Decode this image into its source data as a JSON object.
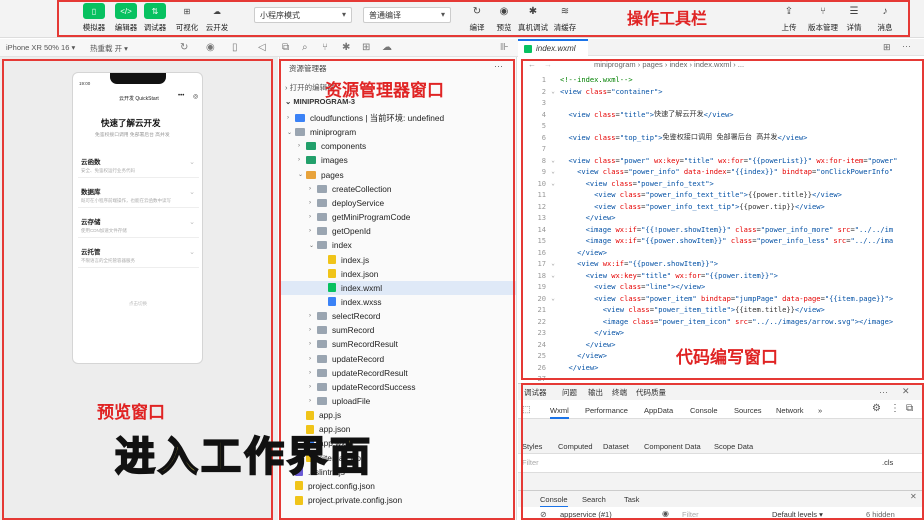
{
  "toolbar": {
    "left_buttons": [
      {
        "label": "模拟器",
        "icon": "phone-icon",
        "glyph": "▯"
      },
      {
        "label": "编辑器",
        "icon": "code-icon",
        "glyph": "</>"
      },
      {
        "label": "调试器",
        "icon": "debug-icon",
        "glyph": "⇅"
      },
      {
        "label": "可视化",
        "icon": "grid-icon",
        "glyph": "⊞"
      },
      {
        "label": "云开发",
        "icon": "cloud-icon",
        "glyph": "☁"
      }
    ],
    "mode_select": "小程序模式",
    "compile_select": "普通编译",
    "mid_buttons": [
      {
        "label": "编译",
        "icon": "refresh-icon",
        "glyph": "↻"
      },
      {
        "label": "预览",
        "icon": "eye-icon",
        "glyph": "◉"
      },
      {
        "label": "真机调试",
        "icon": "bug-icon",
        "glyph": "✱"
      },
      {
        "label": "清缓存",
        "icon": "layers-icon",
        "glyph": "≋"
      }
    ],
    "right_buttons": [
      {
        "label": "上传",
        "icon": "upload-icon",
        "glyph": "⇪"
      },
      {
        "label": "版本管理",
        "icon": "branch-icon",
        "glyph": "⑂"
      },
      {
        "label": "详情",
        "icon": "menu-icon",
        "glyph": "☰"
      },
      {
        "label": "消息",
        "icon": "bell-icon",
        "glyph": "♪"
      }
    ]
  },
  "subbar": {
    "device": "iPhone XR 50% 16 ▾",
    "hotreload": "热重载 开 ▾"
  },
  "annotations": {
    "toolbar": "操作工具栏",
    "explorer": "资源管理器窗口",
    "editor": "代码编写窗口",
    "preview": "预览窗口"
  },
  "subtitle": "进入工作界面",
  "preview": {
    "nav_title": "云开发 QuickStart",
    "time": "19:00",
    "heading": "快速了解云开发",
    "subheading": "免鉴权接口调用 免部署后台 高并发",
    "cards": [
      {
        "title": "云函数",
        "sub": "安全、免鉴权运行业务代码"
      },
      {
        "title": "数据库",
        "sub": "既可在小程序前端操作，也能在云函数中读写"
      },
      {
        "title": "云存储",
        "sub": "使用CDN加速文件存储"
      },
      {
        "title": "云托管",
        "sub": "不限语言的全托管容器服务"
      }
    ],
    "footer": "点击切换"
  },
  "explorer": {
    "title": "资源管理器",
    "opened_label": "打开的编辑器",
    "project": "MINIPROGRAM-3",
    "tree": [
      {
        "label": "cloudfunctions | 当前环境: undefined",
        "depth": 0,
        "arrow": "›",
        "type": "folder-cloud"
      },
      {
        "label": "miniprogram",
        "depth": 0,
        "arrow": "⌄",
        "type": "folder"
      },
      {
        "label": "components",
        "depth": 1,
        "arrow": "›",
        "type": "folder-green"
      },
      {
        "label": "images",
        "depth": 1,
        "arrow": "›",
        "type": "folder-green"
      },
      {
        "label": "pages",
        "depth": 1,
        "arrow": "⌄",
        "type": "folder-orange"
      },
      {
        "label": "createCollection",
        "depth": 2,
        "arrow": "›",
        "type": "folder"
      },
      {
        "label": "deployService",
        "depth": 2,
        "arrow": "›",
        "type": "folder"
      },
      {
        "label": "getMiniProgramCode",
        "depth": 2,
        "arrow": "›",
        "type": "folder"
      },
      {
        "label": "getOpenId",
        "depth": 2,
        "arrow": "›",
        "type": "folder"
      },
      {
        "label": "index",
        "depth": 2,
        "arrow": "⌄",
        "type": "folder"
      },
      {
        "label": "index.js",
        "depth": 3,
        "arrow": "",
        "type": "js"
      },
      {
        "label": "index.json",
        "depth": 3,
        "arrow": "",
        "type": "json"
      },
      {
        "label": "index.wxml",
        "depth": 3,
        "arrow": "",
        "type": "wxml",
        "selected": true
      },
      {
        "label": "index.wxss",
        "depth": 3,
        "arrow": "",
        "type": "wxss"
      },
      {
        "label": "selectRecord",
        "depth": 2,
        "arrow": "›",
        "type": "folder"
      },
      {
        "label": "sumRecord",
        "depth": 2,
        "arrow": "›",
        "type": "folder"
      },
      {
        "label": "sumRecordResult",
        "depth": 2,
        "arrow": "›",
        "type": "folder"
      },
      {
        "label": "updateRecord",
        "depth": 2,
        "arrow": "›",
        "type": "folder"
      },
      {
        "label": "updateRecordResult",
        "depth": 2,
        "arrow": "›",
        "type": "folder"
      },
      {
        "label": "updateRecordSuccess",
        "depth": 2,
        "arrow": "›",
        "type": "folder"
      },
      {
        "label": "uploadFile",
        "depth": 2,
        "arrow": "›",
        "type": "folder"
      },
      {
        "label": "app.js",
        "depth": 1,
        "arrow": "",
        "type": "js"
      },
      {
        "label": "app.json",
        "depth": 1,
        "arrow": "",
        "type": "json"
      },
      {
        "label": "app.wxss",
        "depth": 1,
        "arrow": "",
        "type": "wxss"
      },
      {
        "label": "sitemap.json",
        "depth": 1,
        "arrow": "",
        "type": "json"
      },
      {
        "label": ".eslintrc.js",
        "depth": 0,
        "arrow": "",
        "type": "eslint"
      },
      {
        "label": "project.config.json",
        "depth": 0,
        "arrow": "",
        "type": "json"
      },
      {
        "label": "project.private.config.json",
        "depth": 0,
        "arrow": "",
        "type": "json"
      }
    ]
  },
  "editor": {
    "tab": "index.wxml",
    "breadcrumb": "miniprogram › pages › index › index.wxml › ...",
    "lines": [
      [
        {
          "c": "cm",
          "t": "<!--index.wxml-->"
        }
      ],
      [
        {
          "c": "v",
          "t": "<view"
        },
        {
          "c": "a",
          "t": " class"
        },
        {
          "c": "tx",
          "t": "="
        },
        {
          "c": "v",
          "t": "\"container\""
        },
        {
          "c": "v",
          "t": ">"
        }
      ],
      [],
      [
        {
          "c": "v",
          "t": "  <view"
        },
        {
          "c": "a",
          "t": " class"
        },
        {
          "c": "tx",
          "t": "="
        },
        {
          "c": "v",
          "t": "\"title\""
        },
        {
          "c": "v",
          "t": ">"
        },
        {
          "c": "tx",
          "t": "快速了解云开发"
        },
        {
          "c": "v",
          "t": "</view>"
        }
      ],
      [],
      [
        {
          "c": "v",
          "t": "  <view"
        },
        {
          "c": "a",
          "t": " class"
        },
        {
          "c": "tx",
          "t": "="
        },
        {
          "c": "v",
          "t": "\"top_tip\""
        },
        {
          "c": "v",
          "t": ">"
        },
        {
          "c": "tx",
          "t": "免鉴权接口调用 免部署后台 高并发"
        },
        {
          "c": "v",
          "t": "</view>"
        }
      ],
      [],
      [
        {
          "c": "v",
          "t": "  <view"
        },
        {
          "c": "a",
          "t": " class"
        },
        {
          "c": "tx",
          "t": "="
        },
        {
          "c": "v",
          "t": "\"power\""
        },
        {
          "c": "a",
          "t": " wx:key"
        },
        {
          "c": "tx",
          "t": "="
        },
        {
          "c": "v",
          "t": "\"title\""
        },
        {
          "c": "a",
          "t": " wx:for"
        },
        {
          "c": "tx",
          "t": "="
        },
        {
          "c": "v",
          "t": "\"{{powerList}}\""
        },
        {
          "c": "a",
          "t": " wx:for-item"
        },
        {
          "c": "tx",
          "t": "="
        },
        {
          "c": "v",
          "t": "\"power\""
        }
      ],
      [
        {
          "c": "v",
          "t": "    <view"
        },
        {
          "c": "a",
          "t": " class"
        },
        {
          "c": "tx",
          "t": "="
        },
        {
          "c": "v",
          "t": "\"power_info\""
        },
        {
          "c": "a",
          "t": " data-index"
        },
        {
          "c": "tx",
          "t": "="
        },
        {
          "c": "v",
          "t": "\"{{index}}\""
        },
        {
          "c": "a",
          "t": " bindtap"
        },
        {
          "c": "tx",
          "t": "="
        },
        {
          "c": "v",
          "t": "\"onClickPowerInfo\""
        }
      ],
      [
        {
          "c": "v",
          "t": "      <view"
        },
        {
          "c": "a",
          "t": " class"
        },
        {
          "c": "tx",
          "t": "="
        },
        {
          "c": "v",
          "t": "\"power_info_text\""
        },
        {
          "c": "v",
          "t": ">"
        }
      ],
      [
        {
          "c": "v",
          "t": "        <view"
        },
        {
          "c": "a",
          "t": " class"
        },
        {
          "c": "tx",
          "t": "="
        },
        {
          "c": "v",
          "t": "\"power_info_text_title\""
        },
        {
          "c": "v",
          "t": ">"
        },
        {
          "c": "tx",
          "t": "{{power.title}}"
        },
        {
          "c": "v",
          "t": "</view>"
        }
      ],
      [
        {
          "c": "v",
          "t": "        <view"
        },
        {
          "c": "a",
          "t": " class"
        },
        {
          "c": "tx",
          "t": "="
        },
        {
          "c": "v",
          "t": "\"power_info_text_tip\""
        },
        {
          "c": "v",
          "t": ">"
        },
        {
          "c": "tx",
          "t": "{{power.tip}}"
        },
        {
          "c": "v",
          "t": "</view>"
        }
      ],
      [
        {
          "c": "v",
          "t": "      </view>"
        }
      ],
      [
        {
          "c": "v",
          "t": "      <image"
        },
        {
          "c": "a",
          "t": " wx:if"
        },
        {
          "c": "tx",
          "t": "="
        },
        {
          "c": "v",
          "t": "\"{{!power.showItem}}\""
        },
        {
          "c": "a",
          "t": " class"
        },
        {
          "c": "tx",
          "t": "="
        },
        {
          "c": "v",
          "t": "\"power_info_more\""
        },
        {
          "c": "a",
          "t": " src"
        },
        {
          "c": "tx",
          "t": "="
        },
        {
          "c": "v",
          "t": "\"../../im"
        }
      ],
      [
        {
          "c": "v",
          "t": "      <image"
        },
        {
          "c": "a",
          "t": " wx:if"
        },
        {
          "c": "tx",
          "t": "="
        },
        {
          "c": "v",
          "t": "\"{{power.showItem}}\""
        },
        {
          "c": "a",
          "t": " class"
        },
        {
          "c": "tx",
          "t": "="
        },
        {
          "c": "v",
          "t": "\"power_info_less\""
        },
        {
          "c": "a",
          "t": " src"
        },
        {
          "c": "tx",
          "t": "="
        },
        {
          "c": "v",
          "t": "\"../../ima"
        }
      ],
      [
        {
          "c": "v",
          "t": "    </view>"
        }
      ],
      [
        {
          "c": "v",
          "t": "    <view"
        },
        {
          "c": "a",
          "t": " wx:if"
        },
        {
          "c": "tx",
          "t": "="
        },
        {
          "c": "v",
          "t": "\"{{power.showItem}}\""
        },
        {
          "c": "v",
          "t": ">"
        }
      ],
      [
        {
          "c": "v",
          "t": "      <view"
        },
        {
          "c": "a",
          "t": " wx:key"
        },
        {
          "c": "tx",
          "t": "="
        },
        {
          "c": "v",
          "t": "\"title\""
        },
        {
          "c": "a",
          "t": " wx:for"
        },
        {
          "c": "tx",
          "t": "="
        },
        {
          "c": "v",
          "t": "\"{{power.item}}\""
        },
        {
          "c": "v",
          "t": ">"
        }
      ],
      [
        {
          "c": "v",
          "t": "        <view"
        },
        {
          "c": "a",
          "t": " class"
        },
        {
          "c": "tx",
          "t": "="
        },
        {
          "c": "v",
          "t": "\"line\""
        },
        {
          "c": "v",
          "t": "></view>"
        }
      ],
      [
        {
          "c": "v",
          "t": "        <view"
        },
        {
          "c": "a",
          "t": " class"
        },
        {
          "c": "tx",
          "t": "="
        },
        {
          "c": "v",
          "t": "\"power_item\""
        },
        {
          "c": "a",
          "t": " bindtap"
        },
        {
          "c": "tx",
          "t": "="
        },
        {
          "c": "v",
          "t": "\"jumpPage\""
        },
        {
          "c": "a",
          "t": " data-page"
        },
        {
          "c": "tx",
          "t": "="
        },
        {
          "c": "v",
          "t": "\"{{item.page}}\""
        },
        {
          "c": "v",
          "t": ">"
        }
      ],
      [
        {
          "c": "v",
          "t": "          <view"
        },
        {
          "c": "a",
          "t": " class"
        },
        {
          "c": "tx",
          "t": "="
        },
        {
          "c": "v",
          "t": "\"power_item_title\""
        },
        {
          "c": "v",
          "t": ">"
        },
        {
          "c": "tx",
          "t": "{{item.title}}"
        },
        {
          "c": "v",
          "t": "</view>"
        }
      ],
      [
        {
          "c": "v",
          "t": "          <image"
        },
        {
          "c": "a",
          "t": " class"
        },
        {
          "c": "tx",
          "t": "="
        },
        {
          "c": "v",
          "t": "\"power_item_icon\""
        },
        {
          "c": "a",
          "t": " src"
        },
        {
          "c": "tx",
          "t": "="
        },
        {
          "c": "v",
          "t": "\"../../images/arrow.svg\""
        },
        {
          "c": "v",
          "t": "></image>"
        }
      ],
      [
        {
          "c": "v",
          "t": "        </view>"
        }
      ],
      [
        {
          "c": "v",
          "t": "      </view>"
        }
      ],
      [
        {
          "c": "v",
          "t": "    </view>"
        }
      ],
      [
        {
          "c": "v",
          "t": "  </view>"
        }
      ],
      []
    ],
    "folds": [
      "",
      "⌄",
      "",
      "",
      "",
      "",
      "",
      "⌄",
      "⌄",
      "⌄",
      "",
      "",
      "",
      "",
      "",
      "",
      "⌄",
      "⌄",
      "",
      "⌄",
      "",
      "",
      "",
      "",
      "",
      "",
      ""
    ]
  },
  "devtools": {
    "top_tabs": [
      "调试器",
      "问题",
      "输出",
      "终端",
      "代码质量"
    ],
    "panel_tabs": [
      "Wxml",
      "Performance",
      "AppData",
      "Console",
      "Sources",
      "Network",
      "»"
    ],
    "sub_tabs": [
      "Styles",
      "Computed",
      "Dataset",
      "Component Data",
      "Scope Data"
    ],
    "filter_placeholder": "Filter",
    "cls": ".cls",
    "drawer_tabs": [
      "Console",
      "Search",
      "Task"
    ],
    "context": "appservice (#1)",
    "filter2": "Filter",
    "levels": "Default levels ▾",
    "hidden": "6 hidden"
  }
}
